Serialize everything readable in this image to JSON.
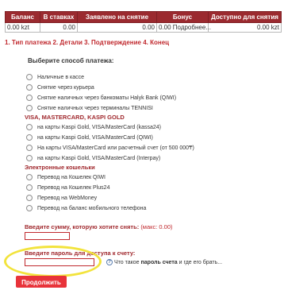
{
  "balance_table": {
    "headers": [
      "Баланс",
      "В ставках",
      "Заявлено на снятие",
      "Бонус",
      "Доступно для снятия"
    ],
    "row": [
      "0.00 kzt",
      "0.00",
      "0.00",
      "0.00 Подробнее...",
      "0.00 kzt"
    ]
  },
  "steps": "1. Тип платежа 2. Детали 3. Подтверждение 4. Конец",
  "prompt": "Выберите способ платежа:",
  "options_cash": [
    "Наличные в кассе",
    "Снятие через курьера",
    "Снятие наличных через банкоматы Halyk Bank (QIWI)",
    "Снятие наличных через терминалы TENNISI"
  ],
  "group_cards": "VISA, MASTERCARD, KASPI GOLD",
  "options_cards": [
    "на карты Kaspi Gold, VISA/MasterCard (kassa24)",
    "на карты Kaspi Gold, VISA/MasterCard (QIWI)",
    "На карты VISA/MasterCard или расчетный счет (от 500 000₸)",
    "на карты Kaspi Gold, VISA/MasterCard (Interpay)"
  ],
  "group_wallets": "Электронные кошельки",
  "options_wallets": [
    "Перевод на Кошелек QIWI",
    "Перевод на Кошелек Plus24",
    "Перевод на WebMoney",
    "Перевод на баланс мобильного телефона"
  ],
  "amount": {
    "label": "Введите сумму, которую хотите снять:",
    "max": "(макс: 0.00)",
    "value": ""
  },
  "password": {
    "label": "Введите пароль для доступа к счету:",
    "value": ""
  },
  "help": {
    "icon": "?",
    "prefix": "Что такое ",
    "bold": "пароль счета",
    "suffix": " и где его брать..."
  },
  "continue_label": "Продолжить"
}
